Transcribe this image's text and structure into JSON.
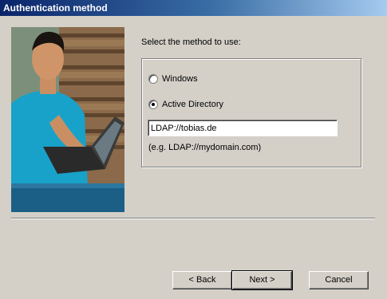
{
  "window": {
    "title": "Authentication method"
  },
  "main": {
    "prompt": "Select the method to use:",
    "options": [
      {
        "label": "Windows",
        "selected": false
      },
      {
        "label": "Active Directory",
        "selected": true
      }
    ],
    "ldap": {
      "value": "LDAP://tobias.de"
    },
    "hint": "(e.g. LDAP://mydomain.com)"
  },
  "buttons": {
    "back": "< Back",
    "next": "Next >",
    "cancel": "Cancel"
  },
  "colors": {
    "titlebar_start": "#0a246a",
    "titlebar_end": "#a6caf0",
    "dialog_bg": "#d4d0c8"
  }
}
